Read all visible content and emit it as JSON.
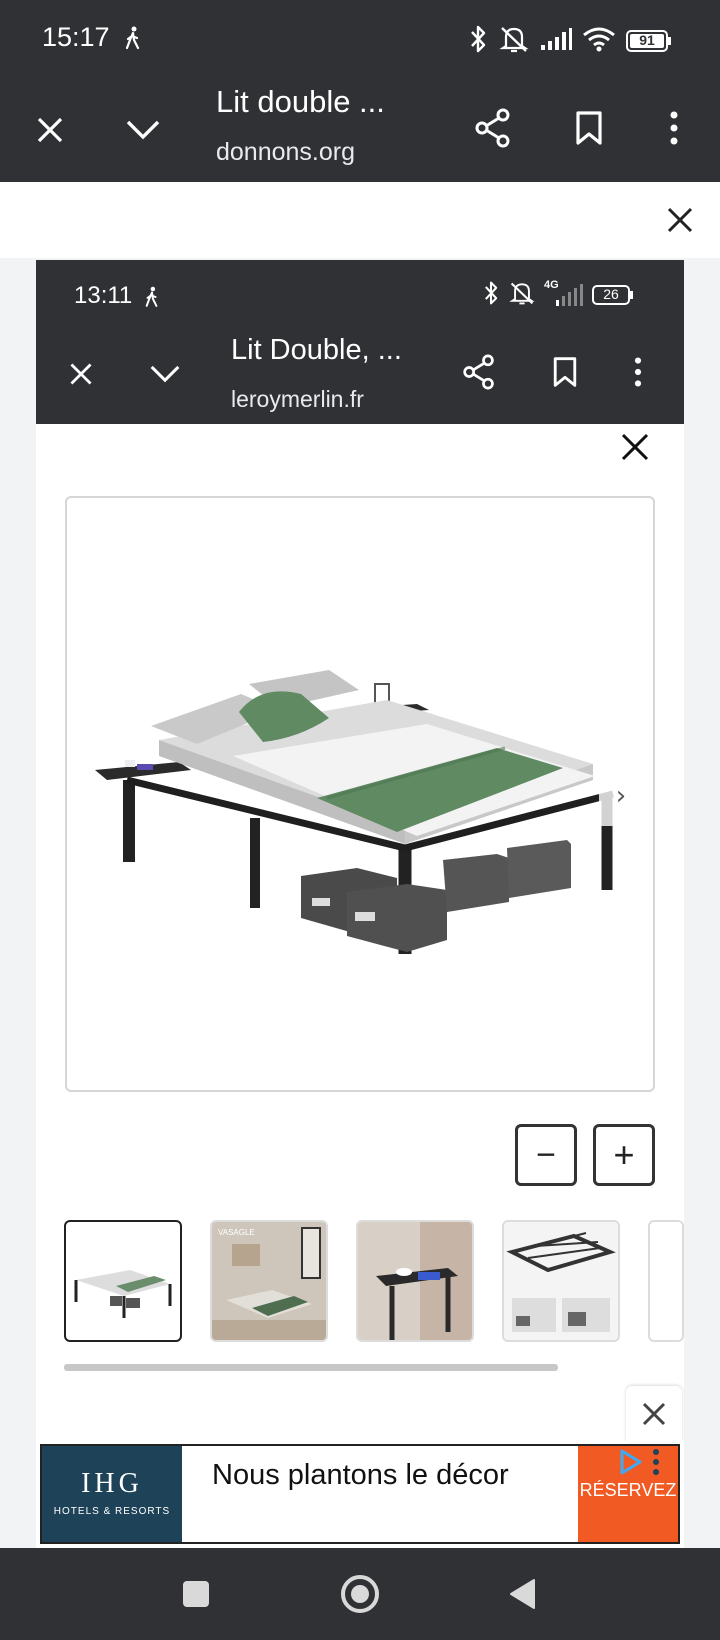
{
  "outer_status": {
    "time": "15:17",
    "battery": "91"
  },
  "outer_toolbar": {
    "title": "Lit double ...",
    "url": "donnons.org"
  },
  "inner_status": {
    "time": "13:11",
    "network": "4G",
    "battery": "26"
  },
  "inner_toolbar": {
    "title": "Lit Double, ...",
    "url": "leroymerlin.fr"
  },
  "gallery": {
    "zoom_out_label": "−",
    "zoom_in_label": "+",
    "next_label": "›",
    "thumb_1_caption": "VASAGLE"
  },
  "ad": {
    "brand": "IHG",
    "brand_sub": "HOTELS & RESORTS",
    "headline": "Nous plantons le décor",
    "cta": "RÉSERVEZ"
  },
  "colors": {
    "chrome_dark": "#303134",
    "ad_navy": "#1e4359",
    "ad_orange": "#f15a22",
    "throw_green": "#5f8a62"
  },
  "icons": [
    "walking-icon",
    "bluetooth-icon",
    "mute-bell-icon",
    "signal-icon",
    "wifi-icon",
    "battery-icon",
    "close-icon",
    "chevron-down-icon",
    "share-icon",
    "bookmark-icon",
    "more-vert-icon",
    "square-nav-icon",
    "circle-nav-icon",
    "back-nav-icon",
    "adchoices-icon"
  ]
}
